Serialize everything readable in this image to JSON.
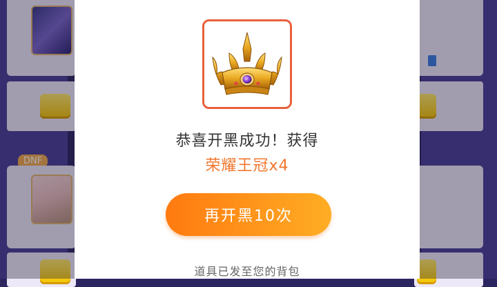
{
  "background": {
    "game_tag": "DNF"
  },
  "modal": {
    "prize_icon": "golden-crown",
    "message": "恭喜开黑成功！获得",
    "reward": "荣耀王冠x4",
    "again_button": "再开黑10次",
    "note": "道具已发至您的背包"
  },
  "colors": {
    "accent_orange": "#f0762c",
    "button_gradient_start": "#ff7a10",
    "button_gradient_end": "#ffad24",
    "prize_border": "#e8603c",
    "background_purple": "#4a3e95"
  }
}
